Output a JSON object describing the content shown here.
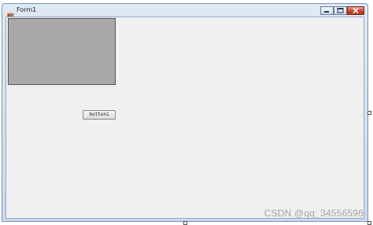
{
  "window": {
    "title": "Form1",
    "controls": {
      "minimize_icon": "minimize-icon",
      "maximize_icon": "maximize-icon",
      "close_icon": "close-icon"
    }
  },
  "form": {
    "panel": {
      "color": "#a9a9a9"
    },
    "button1": {
      "label": "button1"
    }
  },
  "watermark": {
    "text": "CSDN @qq_34556596"
  },
  "colors": {
    "form_background": "#f0f0f0",
    "titlebar": "#c9d9ee",
    "close_button": "#c7412d"
  }
}
